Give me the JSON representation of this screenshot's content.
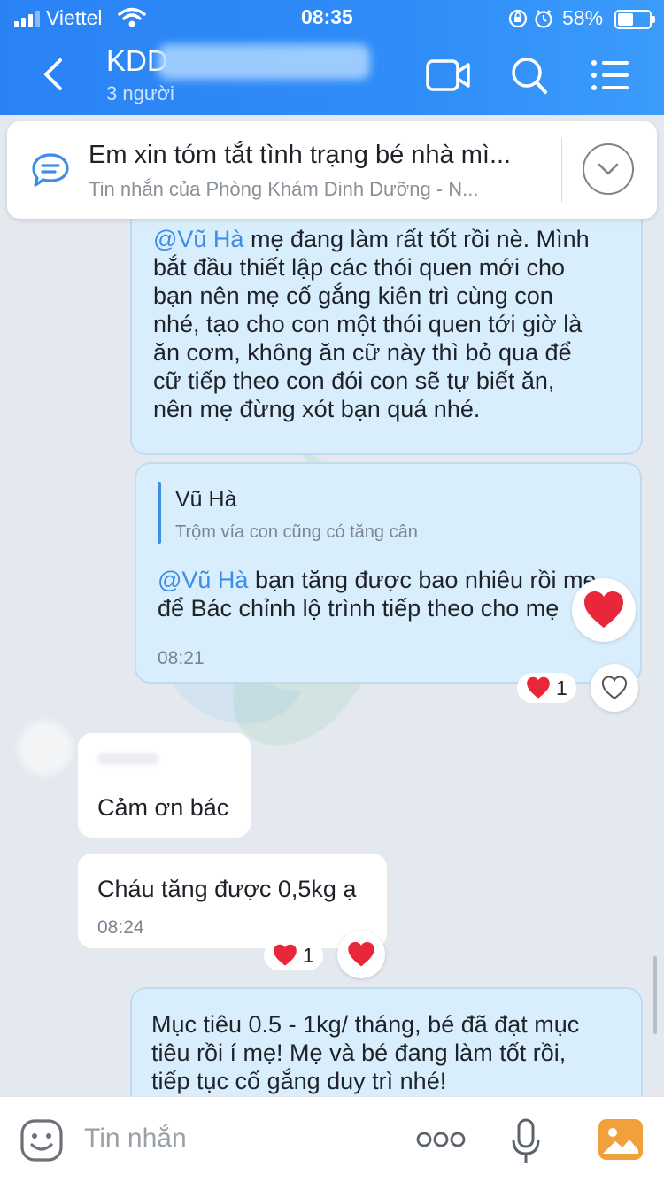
{
  "status_bar": {
    "carrier": "Viettel",
    "time": "08:35",
    "battery": "58%",
    "battery_level": 0.58
  },
  "header": {
    "title": "KDD",
    "subtitle": "3 người"
  },
  "pinned": {
    "title": "Em xin tóm tắt tình trạng bé nhà mì...",
    "subtitle": "Tin nhắn của Phòng Khám Dinh Dưỡng - N..."
  },
  "messages": {
    "m1": {
      "mention": "@Vũ Hà",
      "lines": [
        " mẹ đang làm rất tốt rồi nè. Mình",
        "bắt đầu thiết lập các thói quen mới cho",
        "bạn nên mẹ cố gắng kiên trì cùng con",
        "nhé, tạo cho con một thói quen tới giờ là",
        "ăn cơm, không ăn cữ này thì bỏ qua để",
        "cữ tiếp theo con đói con sẽ tự biết ăn,",
        "nên mẹ đừng xót bạn quá nhé."
      ]
    },
    "m2": {
      "quote_author": "Vũ Hà",
      "quote_text": "Trộm vía con cũng có tăng cân",
      "mention": "@Vũ Hà",
      "line1": " bạn tăng được bao nhiêu rồi mẹ",
      "line2": "để Bác chỉnh lộ trình tiếp theo cho mẹ",
      "time": "08:21",
      "reaction_count": "1"
    },
    "m3": {
      "text": "Cảm ơn bác"
    },
    "m4": {
      "text": "Cháu tăng được 0,5kg ạ",
      "time": "08:24",
      "reaction_count": "1"
    },
    "m5": {
      "lines": [
        "Mục tiêu 0.5 - 1kg/ tháng, bé đã đạt mục",
        "tiêu rồi í mẹ! Mẹ và bé đang làm tốt rồi,",
        "tiếp tục cố gắng duy trì nhé!"
      ]
    }
  },
  "input": {
    "placeholder": "Tin nhắn"
  },
  "colors": {
    "header_blue": "#2f8cf8",
    "sent_bubble": "#d9eefc",
    "mention": "#3d8ce8",
    "heart": "#e8283a"
  },
  "icons": [
    "back-icon",
    "video-call-icon",
    "search-icon",
    "menu-list-icon",
    "chat-bubble-icon",
    "chevron-down-icon",
    "heart-icon",
    "heart-outline-icon",
    "emoji-icon",
    "more-icon",
    "mic-icon",
    "image-icon"
  ]
}
